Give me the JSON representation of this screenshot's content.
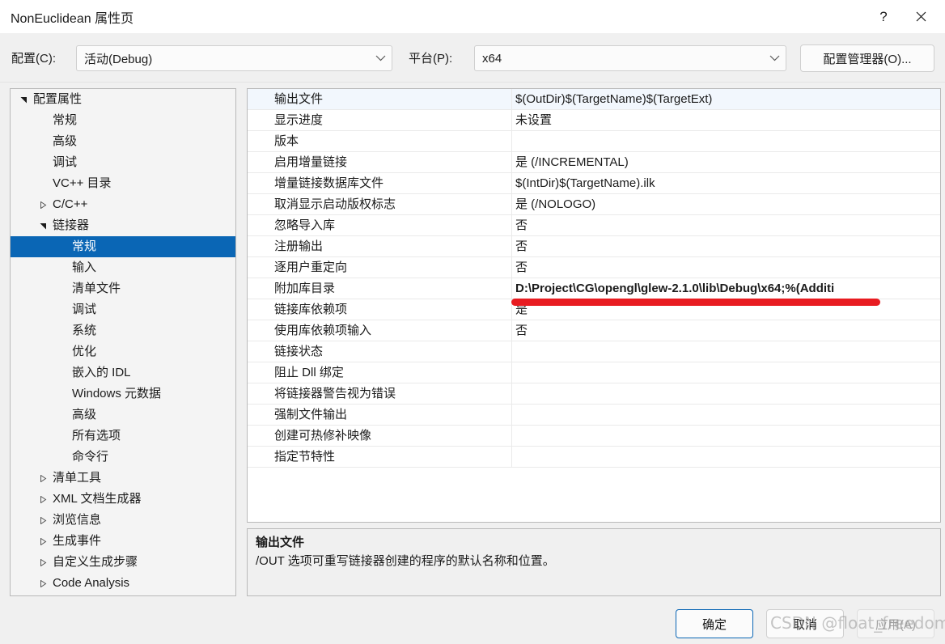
{
  "window": {
    "title": "NonEuclidean 属性页",
    "help_icon": "question-mark-icon",
    "close_icon": "close-icon"
  },
  "configbar": {
    "config_label": "配置(C):",
    "config_value": "活动(Debug)",
    "platform_label": "平台(P):",
    "platform_value": "x64",
    "config_manager_label": "配置管理器(O)..."
  },
  "tree": {
    "items": [
      {
        "label": "配置属性",
        "indent": 0,
        "expander": "expanded",
        "selected": false
      },
      {
        "label": "常规",
        "indent": 1,
        "expander": "none",
        "selected": false
      },
      {
        "label": "高级",
        "indent": 1,
        "expander": "none",
        "selected": false
      },
      {
        "label": "调试",
        "indent": 1,
        "expander": "none",
        "selected": false
      },
      {
        "label": "VC++ 目录",
        "indent": 1,
        "expander": "none",
        "selected": false
      },
      {
        "label": "C/C++",
        "indent": 1,
        "expander": "collapsed",
        "selected": false
      },
      {
        "label": "链接器",
        "indent": 1,
        "expander": "expanded",
        "selected": false
      },
      {
        "label": "常规",
        "indent": 2,
        "expander": "none",
        "selected": true
      },
      {
        "label": "输入",
        "indent": 2,
        "expander": "none",
        "selected": false
      },
      {
        "label": "清单文件",
        "indent": 2,
        "expander": "none",
        "selected": false
      },
      {
        "label": "调试",
        "indent": 2,
        "expander": "none",
        "selected": false
      },
      {
        "label": "系统",
        "indent": 2,
        "expander": "none",
        "selected": false
      },
      {
        "label": "优化",
        "indent": 2,
        "expander": "none",
        "selected": false
      },
      {
        "label": "嵌入的 IDL",
        "indent": 2,
        "expander": "none",
        "selected": false
      },
      {
        "label": "Windows 元数据",
        "indent": 2,
        "expander": "none",
        "selected": false
      },
      {
        "label": "高级",
        "indent": 2,
        "expander": "none",
        "selected": false
      },
      {
        "label": "所有选项",
        "indent": 2,
        "expander": "none",
        "selected": false
      },
      {
        "label": "命令行",
        "indent": 2,
        "expander": "none",
        "selected": false
      },
      {
        "label": "清单工具",
        "indent": 1,
        "expander": "collapsed",
        "selected": false
      },
      {
        "label": "XML 文档生成器",
        "indent": 1,
        "expander": "collapsed",
        "selected": false
      },
      {
        "label": "浏览信息",
        "indent": 1,
        "expander": "collapsed",
        "selected": false
      },
      {
        "label": "生成事件",
        "indent": 1,
        "expander": "collapsed",
        "selected": false
      },
      {
        "label": "自定义生成步骤",
        "indent": 1,
        "expander": "collapsed",
        "selected": false
      },
      {
        "label": "Code Analysis",
        "indent": 1,
        "expander": "collapsed",
        "selected": false
      }
    ]
  },
  "grid": {
    "rows": [
      {
        "name": "输出文件",
        "value": "$(OutDir)$(TargetName)$(TargetExt)",
        "selected": true,
        "bold": false
      },
      {
        "name": "显示进度",
        "value": "未设置",
        "selected": false,
        "bold": false
      },
      {
        "name": "版本",
        "value": "",
        "selected": false,
        "bold": false
      },
      {
        "name": "启用增量链接",
        "value": "是 (/INCREMENTAL)",
        "selected": false,
        "bold": false
      },
      {
        "name": "增量链接数据库文件",
        "value": "$(IntDir)$(TargetName).ilk",
        "selected": false,
        "bold": false
      },
      {
        "name": "取消显示启动版权标志",
        "value": "是 (/NOLOGO)",
        "selected": false,
        "bold": false
      },
      {
        "name": "忽略导入库",
        "value": "否",
        "selected": false,
        "bold": false
      },
      {
        "name": "注册输出",
        "value": "否",
        "selected": false,
        "bold": false
      },
      {
        "name": "逐用户重定向",
        "value": "否",
        "selected": false,
        "bold": false
      },
      {
        "name": "附加库目录",
        "value": "D:\\Project\\CG\\opengl\\glew-2.1.0\\lib\\Debug\\x64;%(Additi",
        "selected": false,
        "bold": true
      },
      {
        "name": "链接库依赖项",
        "value": "是",
        "selected": false,
        "bold": false
      },
      {
        "name": "使用库依赖项输入",
        "value": "否",
        "selected": false,
        "bold": false
      },
      {
        "name": "链接状态",
        "value": "",
        "selected": false,
        "bold": false
      },
      {
        "name": "阻止 Dll 绑定",
        "value": "",
        "selected": false,
        "bold": false
      },
      {
        "name": "将链接器警告视为错误",
        "value": "",
        "selected": false,
        "bold": false
      },
      {
        "name": "强制文件输出",
        "value": "",
        "selected": false,
        "bold": false
      },
      {
        "name": "创建可热修补映像",
        "value": "",
        "selected": false,
        "bold": false
      },
      {
        "name": "指定节特性",
        "value": "",
        "selected": false,
        "bold": false
      }
    ],
    "annotation_color": "#e81c21"
  },
  "description": {
    "title": "输出文件",
    "text": "/OUT 选项可重写链接器创建的程序的默认名称和位置。"
  },
  "footer": {
    "ok_label": "确定",
    "cancel_label": "取消",
    "apply_label": "应用(A)",
    "watermark": "CSDN @float_freedom"
  }
}
